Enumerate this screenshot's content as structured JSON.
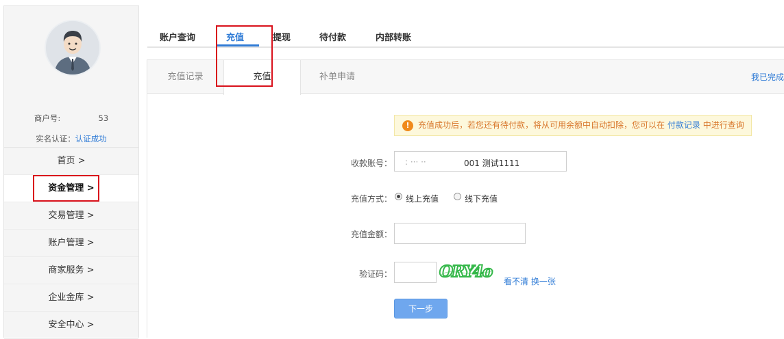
{
  "sidebar": {
    "user_name": "",
    "merchant_label": "商户号:",
    "merchant_no": "53",
    "verify_label": "实名认证：",
    "verify_status": "认证成功",
    "nav": [
      {
        "label": "首页 >"
      },
      {
        "label": "资金管理 >"
      },
      {
        "label": "交易管理 >"
      },
      {
        "label": "账户管理 >"
      },
      {
        "label": "商家服务 >"
      },
      {
        "label": "企业金库 >"
      },
      {
        "label": "安全中心 >"
      }
    ]
  },
  "top_tabs": [
    {
      "label": "账户查询"
    },
    {
      "label": "充值"
    },
    {
      "label": "提现"
    },
    {
      "label": "待付款"
    },
    {
      "label": "内部转账"
    }
  ],
  "sub_tabs": [
    {
      "label": "充值记录"
    },
    {
      "label": "充值"
    },
    {
      "label": "补单申请"
    }
  ],
  "sub_right_link": "我已完成",
  "notice": {
    "icon": "exclamation-icon",
    "text_before": "充值成功后，若您还有待付款，将从可用余额中自动扣除，您可以在",
    "link": "付款记录",
    "text_after": "中进行查询"
  },
  "form": {
    "account_label": "收款账号：",
    "account_value": "001 测试1111",
    "method_label": "充值方式：",
    "method_online": "线上充值",
    "method_offline": "线下充值",
    "amount_label": "充值金额：",
    "amount_value": "",
    "captcha_label": "验证码：",
    "captcha_value": "",
    "captcha_text": "ORY4o",
    "refresh_link": "看不清 换一张",
    "next_button": "下一步"
  },
  "colors": {
    "accent": "#2f7bd6",
    "highlight": "#d9111b",
    "notice_text": "#d8762a",
    "button": "#6fa7ee"
  }
}
